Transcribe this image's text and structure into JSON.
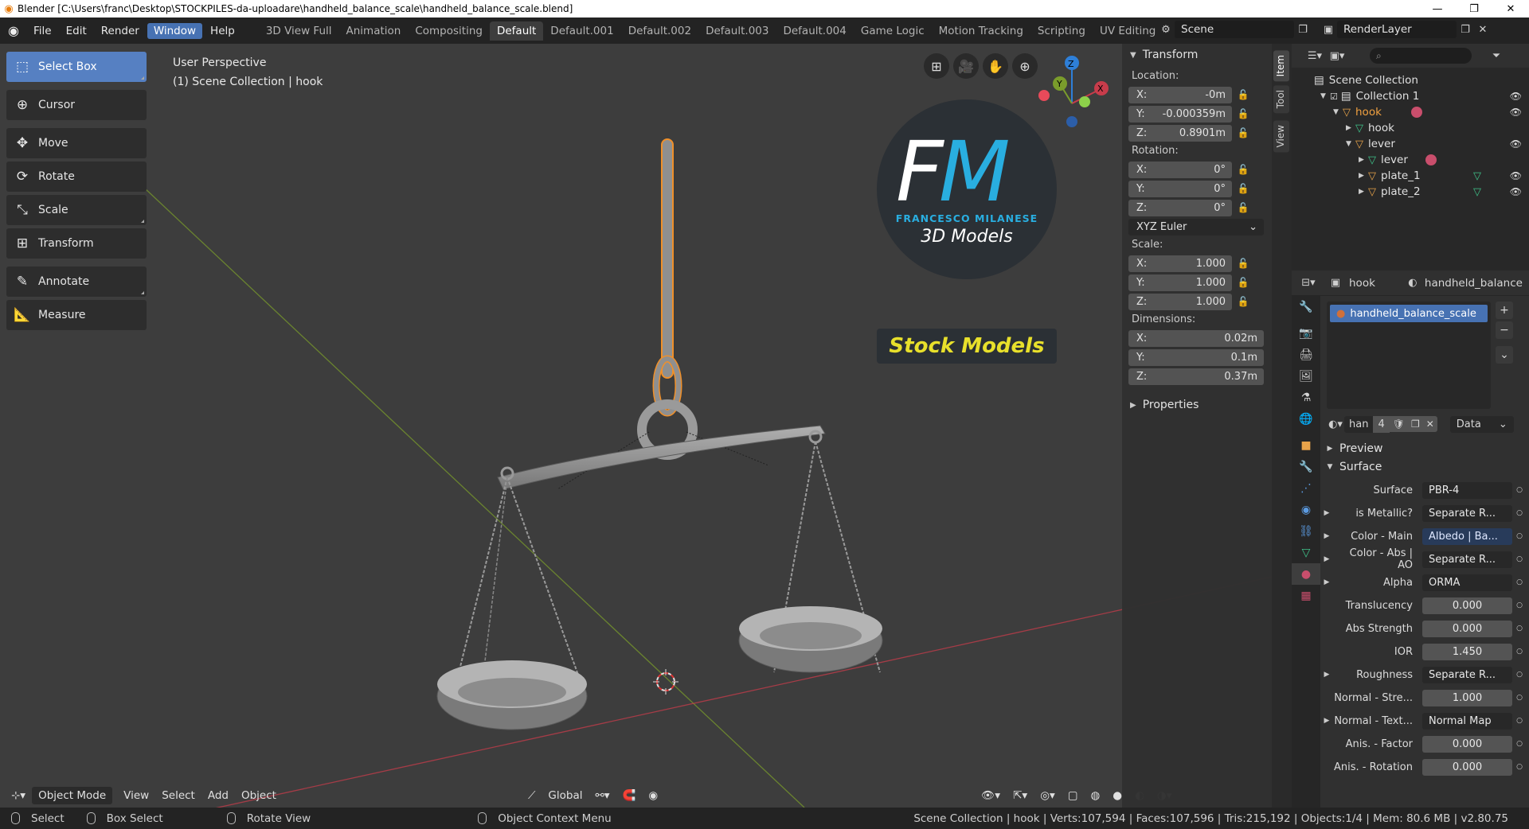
{
  "window": {
    "title": "Blender [C:\\Users\\franc\\Desktop\\STOCKPILES-da-uploadare\\handheld_balance_scale\\handheld_balance_scale.blend]"
  },
  "menu": [
    "File",
    "Edit",
    "Render",
    "Window",
    "Help"
  ],
  "menu_active": "Window",
  "workspaces": [
    "3D View Full",
    "Animation",
    "Compositing",
    "Default",
    "Default.001",
    "Default.002",
    "Default.003",
    "Default.004",
    "Game Logic",
    "Motion Tracking",
    "Scripting",
    "UV Editing"
  ],
  "workspace_active": "Default",
  "scene": "Scene",
  "render_layer": "RenderLayer",
  "viewport": {
    "perspective": "User Perspective",
    "collection": "(1) Scene Collection | hook"
  },
  "tools": [
    {
      "label": "Select Box",
      "icon": "select-box-icon",
      "glyph": "⬚"
    },
    {
      "label": "Cursor",
      "icon": "cursor-icon",
      "glyph": "⊕"
    },
    {
      "label": "Move",
      "icon": "move-icon",
      "glyph": "✥"
    },
    {
      "label": "Rotate",
      "icon": "rotate-icon",
      "glyph": "⟳"
    },
    {
      "label": "Scale",
      "icon": "scale-icon",
      "glyph": "⤡"
    },
    {
      "label": "Transform",
      "icon": "transform-icon",
      "glyph": "⊞"
    },
    {
      "label": "Annotate",
      "icon": "annotate-icon",
      "glyph": "✎"
    },
    {
      "label": "Measure",
      "icon": "measure-icon",
      "glyph": "📐"
    }
  ],
  "watermark": {
    "f": "F",
    "m": "M",
    "name": "FRANCESCO MILANESE",
    "models": "3D Models",
    "stock": "Stock Models"
  },
  "gizmo": {
    "z": "Z",
    "y": "Y",
    "x": "X"
  },
  "npanel": {
    "tabs": [
      "Item",
      "Tool",
      "View"
    ],
    "transform_header": "Transform",
    "location_label": "Location:",
    "location": [
      {
        "axis": "X:",
        "value": "-0m"
      },
      {
        "axis": "Y:",
        "value": "-0.000359m"
      },
      {
        "axis": "Z:",
        "value": "0.8901m"
      }
    ],
    "rotation_label": "Rotation:",
    "rotation": [
      {
        "axis": "X:",
        "value": "0°"
      },
      {
        "axis": "Y:",
        "value": "0°"
      },
      {
        "axis": "Z:",
        "value": "0°"
      }
    ],
    "rotation_mode": "XYZ Euler",
    "scale_label": "Scale:",
    "scale": [
      {
        "axis": "X:",
        "value": "1.000"
      },
      {
        "axis": "Y:",
        "value": "1.000"
      },
      {
        "axis": "Z:",
        "value": "1.000"
      }
    ],
    "dimensions_label": "Dimensions:",
    "dimensions": [
      {
        "axis": "X:",
        "value": "0.02m"
      },
      {
        "axis": "Y:",
        "value": "0.1m"
      },
      {
        "axis": "Z:",
        "value": "0.37m"
      }
    ],
    "properties_header": "Properties"
  },
  "outliner": {
    "root": "Scene Collection",
    "collection": "Collection 1",
    "items": [
      {
        "label": "hook",
        "type": "object",
        "level": 2,
        "highlight": true
      },
      {
        "label": "hook",
        "type": "mesh",
        "level": 3
      },
      {
        "label": "lever",
        "type": "object",
        "level": 3
      },
      {
        "label": "lever",
        "type": "mesh",
        "level": 4
      },
      {
        "label": "plate_1",
        "type": "object",
        "level": 4
      },
      {
        "label": "plate_2",
        "type": "object",
        "level": 4
      }
    ]
  },
  "properties": {
    "object_name": "hook",
    "material_name": "handheld_balance",
    "slot_material": "handheld_balance_scale",
    "mat_short": "han",
    "users": "4",
    "link_mode": "Data",
    "preview": "Preview",
    "surface_section": "Surface",
    "rows": [
      {
        "label": "Surface",
        "value": "PBR-4",
        "tri": false,
        "style": "dark"
      },
      {
        "label": "is Metallic?",
        "value": "Separate R...",
        "tri": true,
        "style": "dark"
      },
      {
        "label": "Color - Main",
        "value": "Albedo | Ba...",
        "tri": true,
        "style": "blue"
      },
      {
        "label": "Color - Abs | AO",
        "value": "Separate R...",
        "tri": true,
        "style": "dark"
      },
      {
        "label": "Alpha",
        "value": "ORMA",
        "tri": true,
        "style": "dark"
      },
      {
        "label": "Translucency",
        "value": "0.000",
        "tri": false,
        "style": "num"
      },
      {
        "label": "Abs Strength",
        "value": "0.000",
        "tri": false,
        "style": "num"
      },
      {
        "label": "IOR",
        "value": "1.450",
        "tri": false,
        "style": "num"
      },
      {
        "label": "Roughness",
        "value": "Separate R...",
        "tri": true,
        "style": "dark"
      },
      {
        "label": "Normal - Stre...",
        "value": "1.000",
        "tri": false,
        "style": "num"
      },
      {
        "label": "Normal - Text...",
        "value": "Normal Map",
        "tri": true,
        "style": "dark"
      },
      {
        "label": "Anis. - Factor",
        "value": "0.000",
        "tri": false,
        "style": "num"
      },
      {
        "label": "Anis. - Rotation",
        "value": "0.000",
        "tri": false,
        "style": "num"
      }
    ]
  },
  "viewport_header": {
    "mode": "Object Mode",
    "menus": [
      "View",
      "Select",
      "Add",
      "Object"
    ],
    "orientation": "Global"
  },
  "statusbar": {
    "select": "Select",
    "box_select": "Box Select",
    "rotate_view": "Rotate View",
    "context_menu": "Object Context Menu",
    "stats": "Scene Collection | hook | Verts:107,594 | Faces:107,596 | Tris:215,192 | Objects:1/4 | Mem: 80.6 MB | v2.80.75"
  },
  "colors": {
    "accent": "#4772b3",
    "selected_outline": "#e8a34a",
    "x_axis": "#c83c4b",
    "y_axis": "#7a9c2b",
    "z_axis": "#2e7fd8"
  }
}
